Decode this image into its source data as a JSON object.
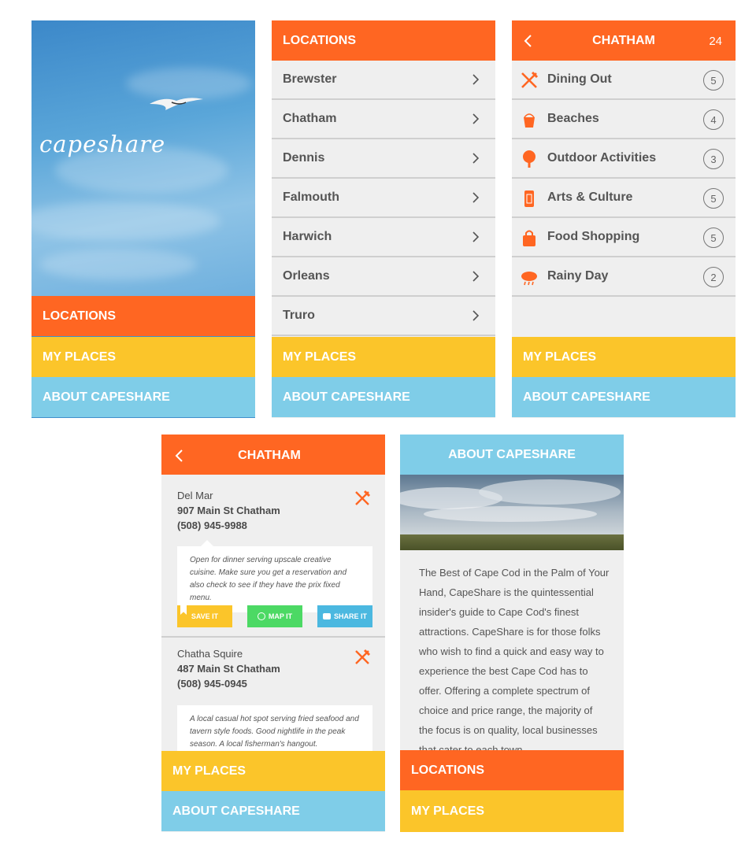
{
  "nav": {
    "locations": "LOCATIONS",
    "my_places": "MY PLACES",
    "about": "ABOUT CAPESHARE"
  },
  "splash": {
    "logo": "capeshare"
  },
  "locations": {
    "title": "LOCATIONS",
    "items": [
      "Brewster",
      "Chatham",
      "Dennis",
      "Falmouth",
      "Harwich",
      "Orleans",
      "Truro"
    ]
  },
  "chatham": {
    "title": "CHATHAM",
    "total": "24",
    "categories": [
      {
        "label": "Dining Out",
        "count": "5",
        "icon": "fork-knife-icon"
      },
      {
        "label": "Beaches",
        "count": "4",
        "icon": "bucket-icon"
      },
      {
        "label": "Outdoor Activities",
        "count": "3",
        "icon": "tree-icon"
      },
      {
        "label": "Arts & Culture",
        "count": "5",
        "icon": "ticket-icon"
      },
      {
        "label": "Food Shopping",
        "count": "5",
        "icon": "shopping-bag-icon"
      },
      {
        "label": "Rainy Day",
        "count": "2",
        "icon": "rain-cloud-icon"
      }
    ]
  },
  "dining": {
    "title": "CHATHAM",
    "listings": [
      {
        "name": "Del Mar",
        "address": "907 Main St Chatham",
        "phone": "(508) 945-9988",
        "description": "Open for dinner serving upscale creative cuisine. Make sure you get a reservation and also check to see if they have the prix fixed menu."
      },
      {
        "name": "Chatha Squire",
        "address": "487 Main St Chatham",
        "phone": "(508) 945-0945",
        "description": "A local casual hot spot serving fried seafood and tavern style foods. Good nightlife in the peak season. A local fisherman's hangout."
      }
    ],
    "actions": {
      "save": "SAVE IT",
      "map": "MAP IT",
      "share": "SHARE IT"
    }
  },
  "about": {
    "title": "ABOUT CAPESHARE",
    "body": "The Best of Cape Cod in the Palm of Your Hand, CapeShare is the quintessential insider's guide to Cape Cod's finest attractions. CapeShare is for those folks who wish to find a quick and easy way to experience the best Cape Cod has to offer. Offering a complete spectrum of choice and price range, the majority of the focus is on quality, local businesses that cater to each town."
  },
  "colors": {
    "orange": "#ff6622",
    "yellow": "#fbc52a",
    "blue": "#7fcde8",
    "green": "#4cd964",
    "list_bg": "#efefef"
  }
}
